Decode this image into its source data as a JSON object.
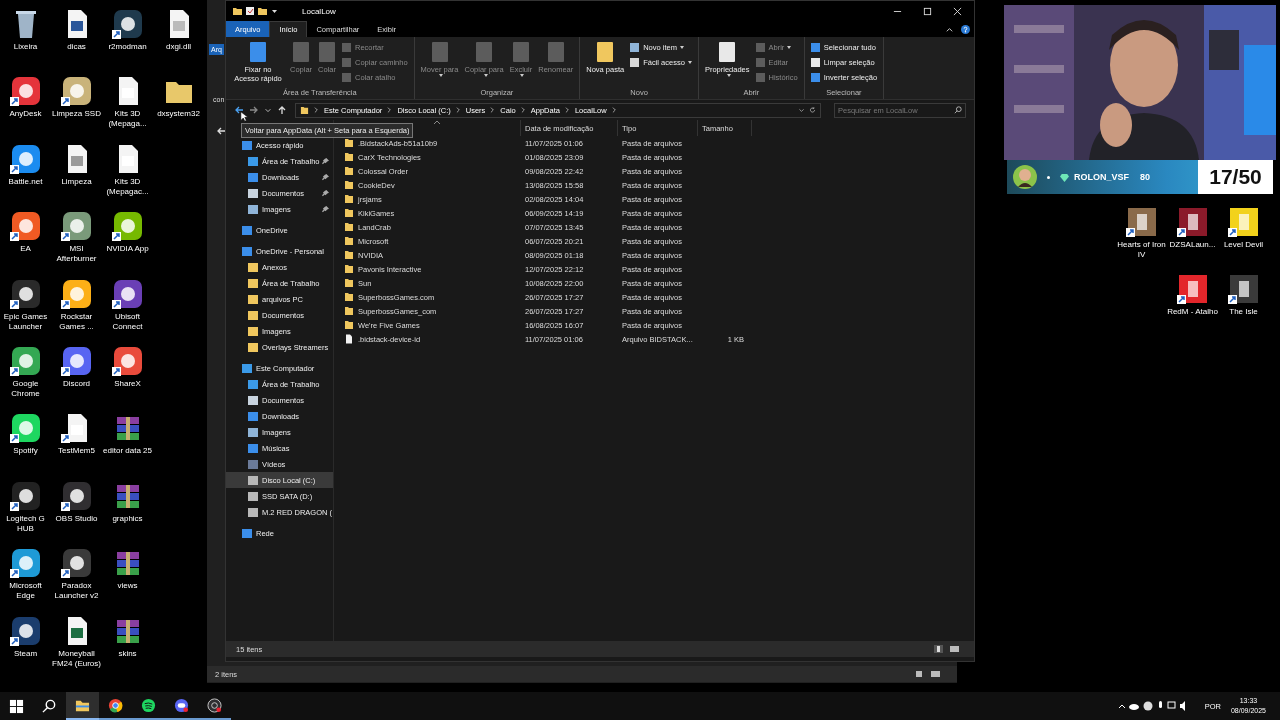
{
  "desktop_left": [
    [
      {
        "label": "Lixeira",
        "kind": "bin",
        "color": "#9fb4c8",
        "shortcut": false
      },
      {
        "label": "AnyDesk",
        "kind": "app",
        "color": "#e5343b",
        "shortcut": true
      },
      {
        "label": "Battle.net",
        "kind": "app",
        "color": "#1b8cf0",
        "shortcut": true
      },
      {
        "label": "EA",
        "kind": "app",
        "color": "#f05a23",
        "shortcut": true
      },
      {
        "label": "Epic Games Launcher",
        "kind": "app",
        "color": "#2a2a2a",
        "shortcut": true
      },
      {
        "label": "Google Chrome",
        "kind": "app",
        "color": "#34a853",
        "shortcut": true
      },
      {
        "label": "Spotify",
        "kind": "app",
        "color": "#1ed760",
        "shortcut": true
      },
      {
        "label": "Logitech G HUB",
        "kind": "app",
        "color": "#222222",
        "shortcut": true
      },
      {
        "label": "Microsoft Edge",
        "kind": "app",
        "color": "#1e9ad6",
        "shortcut": true
      },
      {
        "label": "Steam",
        "kind": "app",
        "color": "#1b3d6d",
        "shortcut": true
      }
    ],
    [
      {
        "label": "dicas",
        "kind": "doc",
        "color": "#2b579a",
        "shortcut": false
      },
      {
        "label": "Limpeza SSD",
        "kind": "app",
        "color": "#c9b37a",
        "shortcut": true
      },
      {
        "label": "Limpeza",
        "kind": "doc",
        "color": "#9a9a9a",
        "shortcut": false
      },
      {
        "label": "MSI Afterburner",
        "kind": "app",
        "color": "#7a9a7a",
        "shortcut": true
      },
      {
        "label": "Rockstar Games ...",
        "kind": "app",
        "color": "#fcaf17",
        "shortcut": true
      },
      {
        "label": "Discord",
        "kind": "app",
        "color": "#5865f2",
        "shortcut": true
      },
      {
        "label": "TestMem5",
        "kind": "doc",
        "color": "#ffffff",
        "shortcut": true
      },
      {
        "label": "OBS Studio",
        "kind": "app",
        "color": "#302e31",
        "shortcut": true
      },
      {
        "label": "Paradox Launcher v2",
        "kind": "app",
        "color": "#3a3a3a",
        "shortcut": true
      },
      {
        "label": "Moneyball FM24 (Euros)",
        "kind": "doc",
        "color": "#1d6f42",
        "shortcut": false
      }
    ],
    [
      {
        "label": "r2modman",
        "kind": "app",
        "color": "#1f3a4d",
        "shortcut": true
      },
      {
        "label": "Kits 3D (Mepaga...",
        "kind": "doc",
        "color": "#ffffff",
        "shortcut": false
      },
      {
        "label": "Kits 3D (Mepagac...",
        "kind": "doc",
        "color": "#ffffff",
        "shortcut": false
      },
      {
        "label": "NVIDIA App",
        "kind": "app",
        "color": "#76b900",
        "shortcut": true
      },
      {
        "label": "Ubisoft Connect",
        "kind": "app",
        "color": "#6a3fb5",
        "shortcut": true
      },
      {
        "label": "ShareX",
        "kind": "app",
        "color": "#e94b3c",
        "shortcut": true
      },
      {
        "label": "editor data 25",
        "kind": "archive",
        "color": "#8a3fa0",
        "shortcut": false
      },
      {
        "label": "graphics",
        "kind": "archive",
        "color": "#8a3fa0",
        "shortcut": false
      },
      {
        "label": "views",
        "kind": "archive",
        "color": "#8a3fa0",
        "shortcut": false
      },
      {
        "label": "skins",
        "kind": "archive",
        "color": "#8a3fa0",
        "shortcut": false
      }
    ],
    [
      {
        "label": "dxgi.dll",
        "kind": "doc",
        "color": "#bbbbbb",
        "shortcut": false
      },
      {
        "label": "dxsystem32",
        "kind": "folder",
        "color": "#e8c86a",
        "shortcut": false
      }
    ]
  ],
  "desktop_right": [
    [
      {
        "label": "Hearts of Iron IV",
        "color": "#8a6a4a",
        "shortcut": true
      },
      {
        "label": "DZSALaun...",
        "color": "#8b1a2a",
        "shortcut": true
      },
      {
        "label": "Level Devil",
        "color": "#f2d21b",
        "shortcut": true
      }
    ],
    [
      {
        "label": "RedM - Atalho",
        "color": "#e3262b",
        "shortcut": true
      },
      {
        "label": "The Isle",
        "color": "#3a3a3a",
        "shortcut": true
      }
    ]
  ],
  "webcam": {
    "kind": "picture"
  },
  "stream_overlay": {
    "username": "ROLON_VSF",
    "points": "80",
    "counter": "17/50"
  },
  "back_window": {
    "tab_fragment": "Arq",
    "path_fragment": "con",
    "status": "2 itens"
  },
  "explorer": {
    "title": "LocalLow",
    "tabs": [
      {
        "label": "Arquivo",
        "kind": "file",
        "selected": false
      },
      {
        "label": "Início",
        "kind": "tab",
        "selected": true
      },
      {
        "label": "Compartilhar",
        "kind": "tab",
        "selected": false
      },
      {
        "label": "Exibir",
        "kind": "tab",
        "selected": false
      }
    ],
    "ribbon": [
      {
        "name": "Área de Transferência",
        "big": [
          {
            "label": "Fixar no Acesso rápido",
            "kind": "pin",
            "disabled": false,
            "menu": false
          },
          {
            "label": "Copiar",
            "kind": "copy",
            "disabled": true,
            "menu": false
          },
          {
            "label": "Colar",
            "kind": "paste",
            "disabled": true,
            "menu": false
          }
        ],
        "small": [
          {
            "label": "Recortar",
            "kind": "cut",
            "disabled": true,
            "menu": false
          },
          {
            "label": "Copiar caminho",
            "kind": "path",
            "disabled": true,
            "menu": false
          },
          {
            "label": "Colar atalho",
            "kind": "paste",
            "disabled": true,
            "menu": false
          }
        ]
      },
      {
        "name": "Organizar",
        "big": [
          {
            "label": "Mover para",
            "kind": "move",
            "disabled": true,
            "menu": true
          },
          {
            "label": "Copiar para",
            "kind": "copy",
            "disabled": true,
            "menu": true
          },
          {
            "label": "Excluir",
            "kind": "delete",
            "disabled": true,
            "menu": true
          },
          {
            "label": "Renomear",
            "kind": "rename",
            "disabled": true,
            "menu": false
          }
        ]
      },
      {
        "name": "Novo",
        "big": [
          {
            "label": "Nova pasta",
            "kind": "folder",
            "disabled": false,
            "menu": false
          }
        ],
        "small": [
          {
            "label": "Novo item",
            "kind": "newitem",
            "disabled": false,
            "menu": true
          },
          {
            "label": "Fácil acesso",
            "kind": "doc",
            "disabled": false,
            "menu": true
          }
        ]
      },
      {
        "name": "Abrir",
        "big": [
          {
            "label": "Propriedades",
            "kind": "props",
            "disabled": false,
            "menu": true
          }
        ],
        "small": [
          {
            "label": "Abrir",
            "kind": "open",
            "disabled": true,
            "menu": true
          },
          {
            "label": "Editar",
            "kind": "edit",
            "disabled": true,
            "menu": false
          },
          {
            "label": "Histórico",
            "kind": "history",
            "disabled": true,
            "menu": false
          }
        ]
      },
      {
        "name": "Selecionar",
        "small": [
          {
            "label": "Selecionar tudo",
            "kind": "selall",
            "disabled": false,
            "menu": false
          },
          {
            "label": "Limpar seleção",
            "kind": "selnone",
            "disabled": false,
            "menu": false
          },
          {
            "label": "Inverter seleção",
            "kind": "selinv",
            "disabled": false,
            "menu": false
          }
        ]
      }
    ],
    "address": [
      "Este Computador",
      "Disco Local (C:)",
      "Users",
      "Caio",
      "AppData",
      "LocalLow"
    ],
    "search": {
      "placeholder": "Pesquisar em LocalLow"
    },
    "tooltip": "Voltar para AppData (Alt + Seta para a Esquerda)",
    "columns": [
      "Data de modificação",
      "Tipo",
      "Tamanho"
    ],
    "nav": [
      {
        "label": "Acesso rápido",
        "kind": "star",
        "selected": false,
        "children": [
          {
            "label": "Área de Trabalho",
            "kind": "desktop",
            "pinned": true,
            "selected": false
          },
          {
            "label": "Downloads",
            "kind": "download",
            "pinned": true,
            "selected": false
          },
          {
            "label": "Documentos",
            "kind": "doc",
            "pinned": true,
            "selected": false
          },
          {
            "label": "Imagens",
            "pinned": true,
            "selected": false
          }
        ]
      },
      {
        "label": "OneDrive",
        "kind": "cloud",
        "selected": false
      },
      {
        "label": "OneDrive - Personal",
        "kind": "cloud",
        "selected": false,
        "children": [
          {
            "label": "Anexos",
            "kind": "folder",
            "pinned": false,
            "selected": false
          },
          {
            "label": "Área de Trabalho",
            "kind": "folder",
            "pinned": false,
            "selected": false
          },
          {
            "label": "arquivos PC",
            "kind": "folder",
            "pinned": false,
            "selected": false
          },
          {
            "label": "Documentos",
            "kind": "folder",
            "pinned": false,
            "selected": false
          },
          {
            "label": "Imagens",
            "kind": "folder",
            "pinned": false,
            "selected": false
          },
          {
            "label": "Overlays Streamers",
            "kind": "folder",
            "pinned": false,
            "selected": false
          }
        ]
      },
      {
        "label": "Este Computador",
        "kind": "pc",
        "selected": false,
        "children": [
          {
            "label": "Área de Trabalho",
            "kind": "desktop",
            "pinned": false,
            "selected": false
          },
          {
            "label": "Documentos",
            "kind": "doc",
            "pinned": false,
            "selected": false
          },
          {
            "label": "Downloads",
            "kind": "download",
            "pinned": false,
            "selected": false
          },
          {
            "label": "Imagens",
            "pinned": false,
            "selected": false
          },
          {
            "label": "Músicas",
            "kind": "music",
            "pinned": false,
            "selected": false
          },
          {
            "label": "Vídeos",
            "kind": "video",
            "pinned": false,
            "selected": false
          },
          {
            "label": "Disco Local (C:)",
            "kind": "drive",
            "pinned": false,
            "selected": true
          },
          {
            "label": "SSD SATA (D:)",
            "kind": "drive",
            "pinned": false,
            "selected": false
          },
          {
            "label": "M.2 RED DRAGON (",
            "kind": "drive",
            "pinned": false,
            "selected": false
          }
        ]
      },
      {
        "label": "Rede",
        "kind": "network",
        "selected": false
      }
    ],
    "files": [
      {
        "name": ".BidstackAds-b51a10b9",
        "modified": "11/07/2025 01:06",
        "type": "Pasta de arquivos",
        "kind": "folder"
      },
      {
        "name": "CarX Technologies",
        "modified": "01/08/2025 23:09",
        "type": "Pasta de arquivos",
        "kind": "folder"
      },
      {
        "name": "Colossal Order",
        "modified": "09/08/2025 22:42",
        "type": "Pasta de arquivos",
        "kind": "folder"
      },
      {
        "name": "CookieDev",
        "modified": "13/08/2025 15:58",
        "type": "Pasta de arquivos",
        "kind": "folder"
      },
      {
        "name": "jrsjams",
        "modified": "02/08/2025 14:04",
        "type": "Pasta de arquivos",
        "kind": "folder"
      },
      {
        "name": "KikiGames",
        "modified": "06/09/2025 14:19",
        "type": "Pasta de arquivos",
        "kind": "folder"
      },
      {
        "name": "LandCrab",
        "modified": "07/07/2025 13:45",
        "type": "Pasta de arquivos",
        "kind": "folder"
      },
      {
        "name": "Microsoft",
        "modified": "06/07/2025 20:21",
        "type": "Pasta de arquivos",
        "kind": "folder"
      },
      {
        "name": "NVIDIA",
        "modified": "08/09/2025 01:18",
        "type": "Pasta de arquivos",
        "kind": "folder"
      },
      {
        "name": "Pavonis Interactive",
        "modified": "12/07/2025 22:12",
        "type": "Pasta de arquivos",
        "kind": "folder"
      },
      {
        "name": "Sun",
        "modified": "10/08/2025 22:00",
        "type": "Pasta de arquivos",
        "kind": "folder"
      },
      {
        "name": "SuperbossGames.com",
        "modified": "26/07/2025 17:27",
        "type": "Pasta de arquivos",
        "kind": "folder"
      },
      {
        "name": "SuperbossGames_com",
        "modified": "26/07/2025 17:27",
        "type": "Pasta de arquivos",
        "kind": "folder"
      },
      {
        "name": "We're Five Games",
        "modified": "16/08/2025 16:07",
        "type": "Pasta de arquivos",
        "kind": "folder"
      },
      {
        "name": ".bidstack-device-id",
        "modified": "11/07/2025 01:06",
        "type": "Arquivo BIDSTACK...",
        "size": "1 KB",
        "kind": "file"
      }
    ],
    "status": "15 itens"
  },
  "taskbar": {
    "apps": [
      {
        "kind": "start",
        "active": false,
        "running": false
      },
      {
        "kind": "search",
        "active": false,
        "running": false
      },
      {
        "kind": "explorer",
        "active": true,
        "running": true
      },
      {
        "kind": "chrome",
        "active": false,
        "running": true
      },
      {
        "kind": "spotify",
        "active": false,
        "running": true
      },
      {
        "kind": "discord",
        "active": false,
        "running": true
      },
      {
        "kind": "obs",
        "active": false,
        "running": true
      }
    ],
    "language": "POR",
    "time": "13:33",
    "date": "08/09/2025"
  }
}
